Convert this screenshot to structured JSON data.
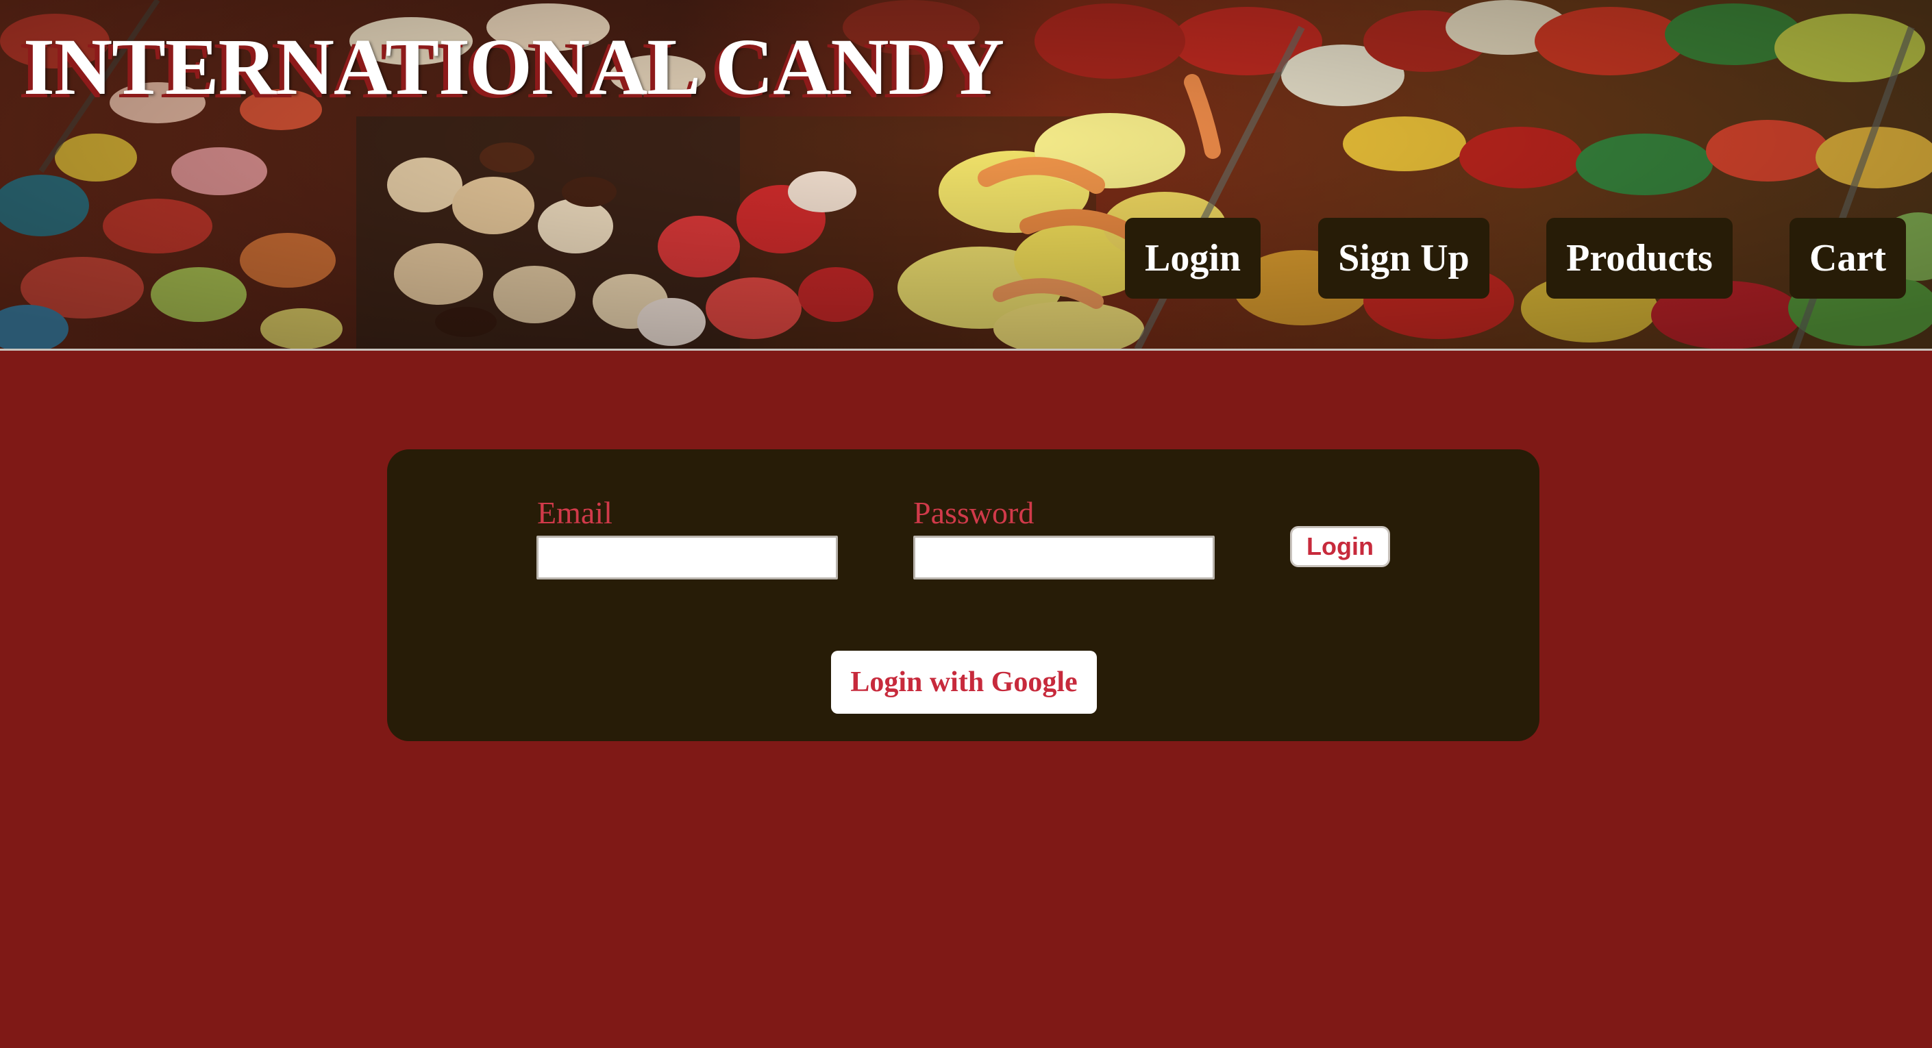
{
  "site": {
    "title": "INTERNATIONAL CANDY"
  },
  "nav": {
    "login": "Login",
    "signup": "Sign Up",
    "products": "Products",
    "cart": "Cart"
  },
  "login_form": {
    "email_label": "Email",
    "email_value": "",
    "password_label": "Password",
    "password_value": "",
    "submit_label": "Login",
    "google_label": "Login with Google"
  },
  "colors": {
    "page_background": "#7f1916",
    "panel_background": "#271c07",
    "nav_button": "#271c07",
    "label_text": "#d13a4a",
    "button_text": "#c72a3c"
  }
}
